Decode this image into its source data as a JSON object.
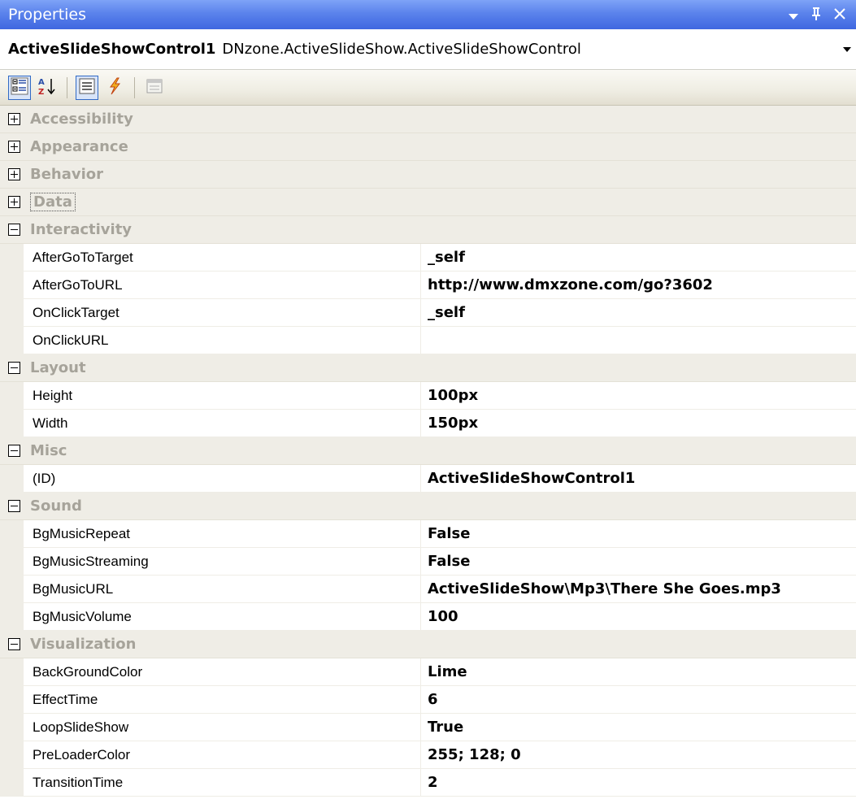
{
  "window": {
    "title": "Properties",
    "controls": {
      "dropdown": "▾",
      "pin": "ᵽ",
      "close": "✕"
    }
  },
  "selector": {
    "object_name": "ActiveSlideShowControl1",
    "object_type": "DNzone.ActiveSlideShow.ActiveSlideShowControl"
  },
  "toolbar": {
    "buttons": [
      "categorized-icon",
      "alphabetical-icon",
      "properties-icon",
      "events-icon",
      "property-pages-icon"
    ]
  },
  "categories": [
    {
      "name": "Accessibility",
      "expanded": false,
      "props": []
    },
    {
      "name": "Appearance",
      "expanded": false,
      "props": []
    },
    {
      "name": "Behavior",
      "expanded": false,
      "props": []
    },
    {
      "name": "Data",
      "expanded": false,
      "focused": true,
      "props": []
    },
    {
      "name": "Interactivity",
      "expanded": true,
      "props": [
        {
          "name": "AfterGoToTarget",
          "value": "_self"
        },
        {
          "name": "AfterGoToURL",
          "value": "http://www.dmxzone.com/go?3602"
        },
        {
          "name": "OnClickTarget",
          "value": "_self"
        },
        {
          "name": "OnClickURL",
          "value": ""
        }
      ]
    },
    {
      "name": "Layout",
      "expanded": true,
      "props": [
        {
          "name": "Height",
          "value": "100px"
        },
        {
          "name": "Width",
          "value": "150px"
        }
      ]
    },
    {
      "name": "Misc",
      "expanded": true,
      "props": [
        {
          "name": "(ID)",
          "value": "ActiveSlideShowControl1"
        }
      ]
    },
    {
      "name": "Sound",
      "expanded": true,
      "props": [
        {
          "name": "BgMusicRepeat",
          "value": "False"
        },
        {
          "name": "BgMusicStreaming",
          "value": "False"
        },
        {
          "name": "BgMusicURL",
          "value": "ActiveSlideShow\\Mp3\\There She Goes.mp3"
        },
        {
          "name": "BgMusicVolume",
          "value": "100"
        }
      ]
    },
    {
      "name": "Visualization",
      "expanded": true,
      "props": [
        {
          "name": "BackGroundColor",
          "value": "Lime"
        },
        {
          "name": "EffectTime",
          "value": "6"
        },
        {
          "name": "LoopSlideShow",
          "value": "True"
        },
        {
          "name": "PreLoaderColor",
          "value": "255; 128; 0"
        },
        {
          "name": "TransitionTime",
          "value": "2"
        }
      ]
    }
  ]
}
